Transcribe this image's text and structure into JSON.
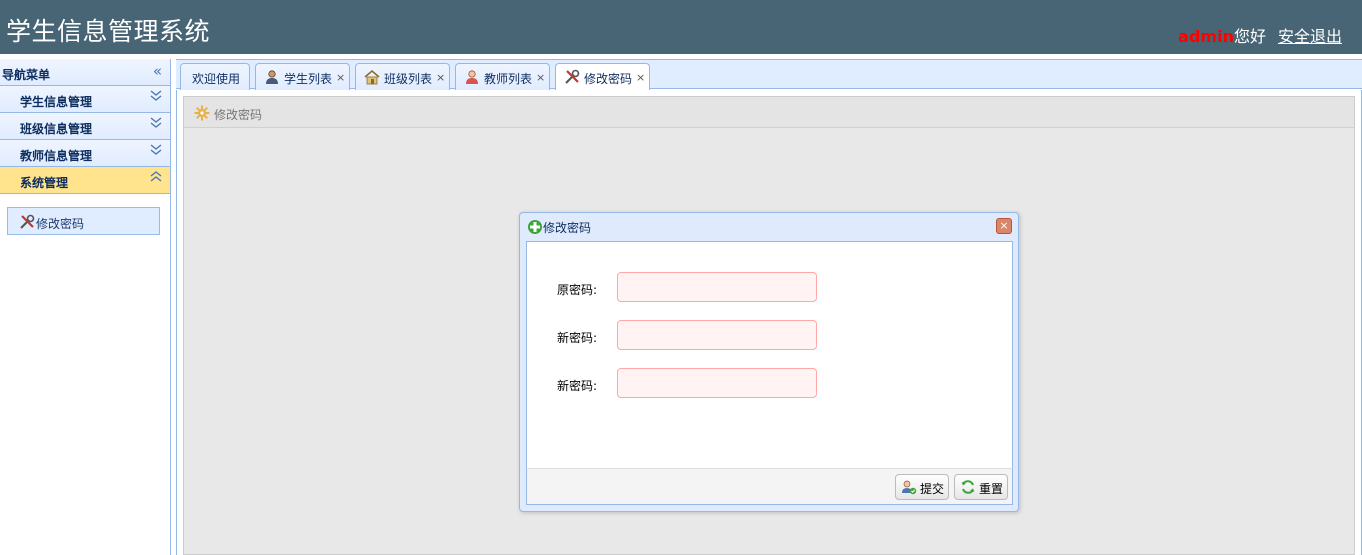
{
  "header": {
    "title": "学生信息管理系统",
    "user_name": "admin",
    "greeting": "您好",
    "logout_label": "安全退出"
  },
  "sidebar": {
    "title": "导航菜单",
    "items": [
      {
        "label": "学生信息管理"
      },
      {
        "label": "班级信息管理"
      },
      {
        "label": "教师信息管理"
      },
      {
        "label": "系统管理"
      }
    ],
    "submenu_link": "修改密码"
  },
  "tabs": [
    {
      "label": "欢迎使用",
      "icon": "none",
      "closable": false
    },
    {
      "label": "学生列表",
      "icon": "student-icon",
      "closable": true
    },
    {
      "label": "班级列表",
      "icon": "house-icon",
      "closable": true
    },
    {
      "label": "教师列表",
      "icon": "teacher-icon",
      "closable": true
    },
    {
      "label": "修改密码",
      "icon": "tools-icon",
      "closable": true,
      "selected": true
    }
  ],
  "close_glyph": "×",
  "panel": {
    "title": "修改密码"
  },
  "dialog": {
    "title": "修改密码",
    "close_glyph": "×",
    "fields": [
      {
        "label": "原密码:",
        "value": ""
      },
      {
        "label": "新密码:",
        "value": ""
      },
      {
        "label": "新密码:",
        "value": ""
      }
    ],
    "buttons": {
      "submit": "提交",
      "reset": "重置"
    }
  },
  "colors": {
    "header_bg": "#486576",
    "accent_blue": "#95b8e7",
    "active_item": "#ffe48d",
    "input_invalid_bg": "#fff3f3",
    "input_invalid_border": "#ffa8a8",
    "username_red": "#ff0000"
  }
}
